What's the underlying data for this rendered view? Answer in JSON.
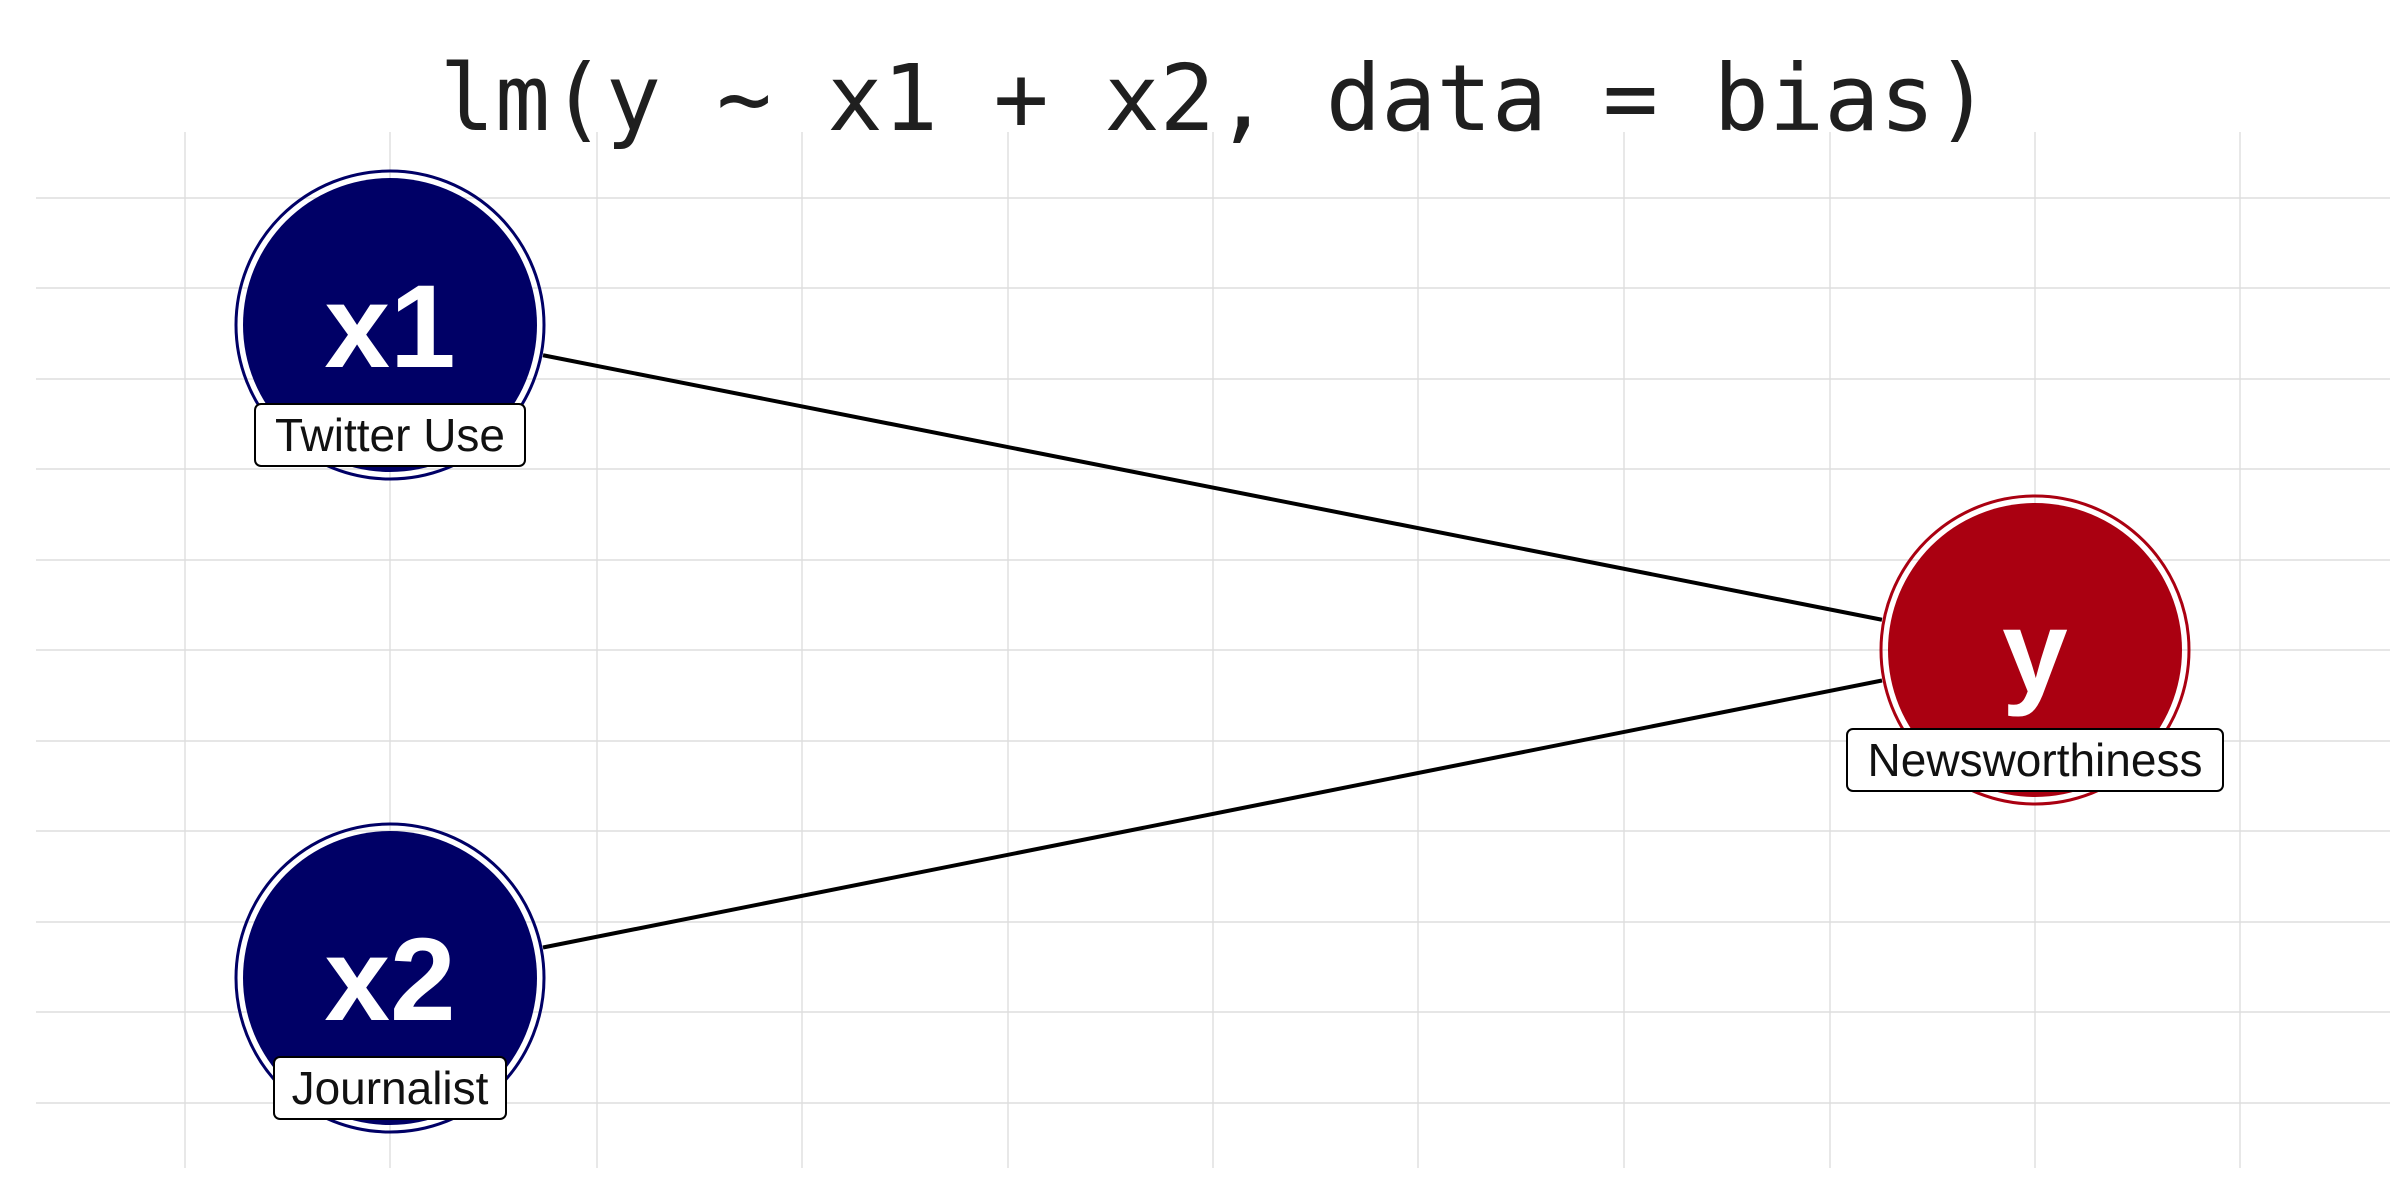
{
  "title": "lm(y ~ x1 + x2, data = bias)",
  "colors": {
    "predictor": "#000066",
    "outcome": "#aa0011",
    "edge": "#000000",
    "grid": "#dedede"
  },
  "nodes": [
    {
      "id": "x1",
      "letter": "x1",
      "label": "Twitter Use",
      "role": "predictor"
    },
    {
      "id": "x2",
      "letter": "x2",
      "label": "Journalist",
      "role": "predictor"
    },
    {
      "id": "y",
      "letter": "y",
      "label": "Newsworthiness",
      "role": "outcome"
    }
  ],
  "edges": [
    {
      "from": "x1",
      "to": "y"
    },
    {
      "from": "x2",
      "to": "y"
    }
  ]
}
